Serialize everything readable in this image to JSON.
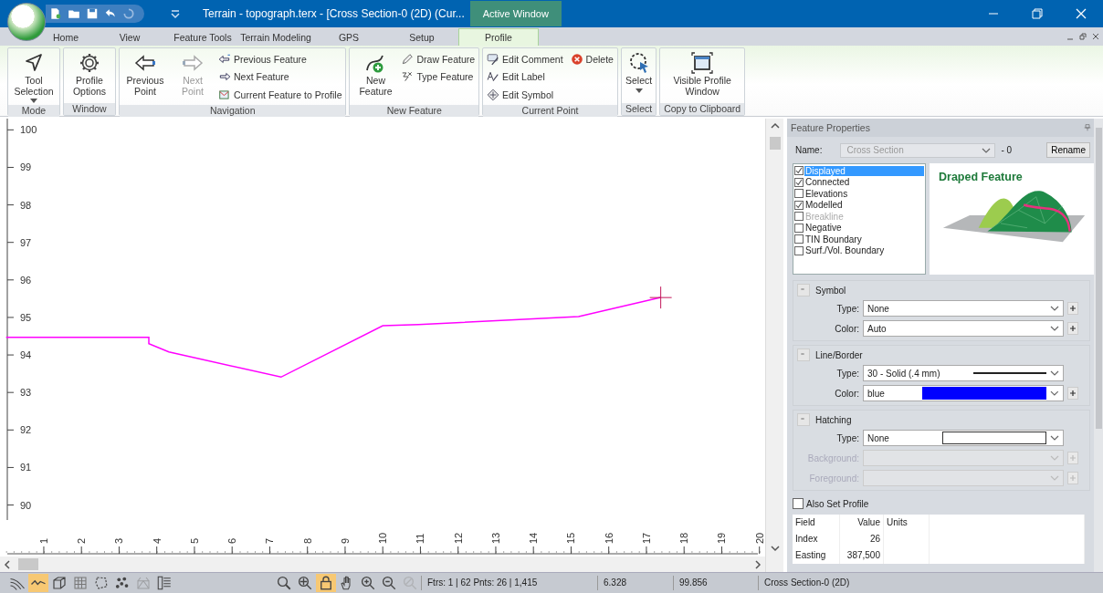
{
  "window": {
    "title": "Terrain - topograph.terx - [Cross Section-0 (2D) (Cur...",
    "context_tab": "Active Window"
  },
  "tabs": [
    {
      "label": "Home",
      "selected": false
    },
    {
      "label": "View",
      "selected": false
    },
    {
      "label": "Feature Tools",
      "selected": false
    },
    {
      "label": "Terrain Modeling",
      "selected": false
    },
    {
      "label": "GPS",
      "selected": false
    },
    {
      "label": "Setup",
      "selected": false
    },
    {
      "label": "Profile",
      "selected": true
    }
  ],
  "ribbon": [
    {
      "title": "Mode",
      "buttons": [
        {
          "label": "Tool Selection",
          "kind": "large",
          "dropdown": true,
          "disabled": false
        }
      ]
    },
    {
      "title": "Window",
      "buttons": [
        {
          "label": "Profile Options",
          "kind": "large",
          "dropdown": false,
          "disabled": false
        }
      ]
    },
    {
      "title": "Navigation",
      "buttons": [
        {
          "label": "Previous Point",
          "kind": "large",
          "dropdown": false,
          "disabled": false
        },
        {
          "label": "Next Point",
          "kind": "large",
          "dropdown": false,
          "disabled": true
        },
        {
          "label": "Previous Feature",
          "kind": "small",
          "disabled": false
        },
        {
          "label": "Next Feature",
          "kind": "small",
          "disabled": false
        },
        {
          "label": "Current Feature to Profile",
          "kind": "small",
          "disabled": false
        }
      ]
    },
    {
      "title": "New Feature",
      "buttons": [
        {
          "label": "New Feature",
          "kind": "large",
          "dropdown": false,
          "disabled": false
        },
        {
          "label": "Draw Feature",
          "kind": "small",
          "disabled": false
        },
        {
          "label": "Type Feature",
          "kind": "small",
          "disabled": false
        }
      ]
    },
    {
      "title": "Current Point",
      "buttons": [
        {
          "label": "Edit Comment",
          "kind": "small",
          "disabled": false
        },
        {
          "label": "Edit Label",
          "kind": "small",
          "disabled": false
        },
        {
          "label": "Edit Symbol",
          "kind": "small",
          "disabled": false
        },
        {
          "label": "Delete",
          "kind": "small",
          "disabled": false
        }
      ]
    },
    {
      "title": "Select",
      "buttons": [
        {
          "label": "Select",
          "kind": "large",
          "dropdown": true,
          "disabled": false
        }
      ]
    },
    {
      "title": "Copy to Clipboard",
      "buttons": [
        {
          "label": "Visible Profile Window",
          "kind": "large",
          "dropdown": false,
          "disabled": false
        }
      ]
    }
  ],
  "profile_view": {
    "chart_data": {
      "type": "line",
      "x": [
        0,
        3.79,
        3.79,
        4.32,
        7.3,
        10.0,
        10.95,
        13.38,
        15.2,
        17.38
      ],
      "series": [
        {
          "color": "#ff00ff",
          "values": [
            94.47,
            94.47,
            94.3,
            94.08,
            93.41,
            94.78,
            94.81,
            94.93,
            95.02,
            95.53
          ]
        }
      ],
      "xlim": [
        0,
        20
      ],
      "ylim": [
        89.6,
        100.3
      ],
      "xticks": [
        1,
        2,
        3,
        4,
        5,
        6,
        7,
        8,
        9,
        10,
        11,
        12,
        13,
        14,
        15,
        16,
        17,
        18,
        19,
        20
      ],
      "yticks": [
        90,
        91,
        92,
        93,
        94,
        95,
        96,
        97,
        98,
        99,
        100
      ]
    }
  },
  "feature_properties": {
    "title": "Feature Properties",
    "name_label": "Name:",
    "name_value": "Cross Section",
    "name_suffix": "- 0",
    "rename": "Rename",
    "flags": [
      {
        "label": "Displayed",
        "checked": true,
        "selected": true,
        "disabled": false
      },
      {
        "label": "Connected",
        "checked": true,
        "selected": false,
        "disabled": false
      },
      {
        "label": "Elevations",
        "checked": false,
        "selected": false,
        "disabled": false
      },
      {
        "label": "Modelled",
        "checked": true,
        "selected": false,
        "disabled": false
      },
      {
        "label": "Breakline",
        "checked": false,
        "selected": false,
        "disabled": true
      },
      {
        "label": "Negative",
        "checked": false,
        "selected": false,
        "disabled": false
      },
      {
        "label": "TIN Boundary",
        "checked": false,
        "selected": false,
        "disabled": false
      },
      {
        "label": "Surf./Vol. Boundary",
        "checked": false,
        "selected": false,
        "disabled": false
      }
    ],
    "preview_title": "Draped Feature",
    "sections": [
      {
        "title": "Symbol",
        "expanded": true,
        "fields": [
          {
            "label": "Type:",
            "value": "None",
            "kind": "plain",
            "disabled": false
          },
          {
            "label": "Color:",
            "value": "Auto",
            "kind": "plain",
            "disabled": false
          }
        ]
      },
      {
        "title": "Line/Border",
        "expanded": true,
        "fields": [
          {
            "label": "Type:",
            "value": "30 - Solid (.4 mm)",
            "kind": "line",
            "disabled": false
          },
          {
            "label": "Color:",
            "value": "blue",
            "kind": "swatch",
            "color": "#0000ff",
            "disabled": false
          }
        ]
      },
      {
        "title": "Hatching",
        "expanded": true,
        "fields": [
          {
            "label": "Type:",
            "value": "None",
            "kind": "empty-swatch",
            "disabled": false
          },
          {
            "label": "Background:",
            "kind": "plain",
            "disabled": true
          },
          {
            "label": "Foreground:",
            "kind": "plain",
            "disabled": true
          }
        ]
      }
    ],
    "also_set_profile": {
      "label": "Also Set Profile",
      "checked": false
    },
    "table": {
      "columns": [
        "Field",
        "Value",
        "Units"
      ],
      "rows": [
        {
          "field": "Index",
          "value": "26"
        },
        {
          "field": "Easting",
          "value": "387,500"
        }
      ]
    }
  },
  "status_bar": {
    "view_buttons": [
      {
        "selected": false,
        "disabled": false
      },
      {
        "selected": true,
        "disabled": false
      },
      {
        "selected": false,
        "disabled": false
      },
      {
        "selected": false,
        "disabled": false
      },
      {
        "selected": false,
        "disabled": false
      },
      {
        "selected": false,
        "disabled": false
      },
      {
        "selected": false,
        "disabled": true
      },
      {
        "selected": false,
        "disabled": false
      }
    ],
    "zoom_buttons": [
      {
        "selected": false,
        "disabled": false
      },
      {
        "selected": false,
        "disabled": false
      },
      {
        "selected": true,
        "disabled": false
      },
      {
        "selected": false,
        "disabled": false
      },
      {
        "selected": false,
        "disabled": false
      },
      {
        "selected": false,
        "disabled": false
      },
      {
        "selected": false,
        "disabled": true
      }
    ],
    "texts": [
      "Ftrs: 1 | 62  Pnts: 26 | 1,415",
      "6.328",
      "99.856",
      "Cross Section-0 (2D)"
    ]
  }
}
